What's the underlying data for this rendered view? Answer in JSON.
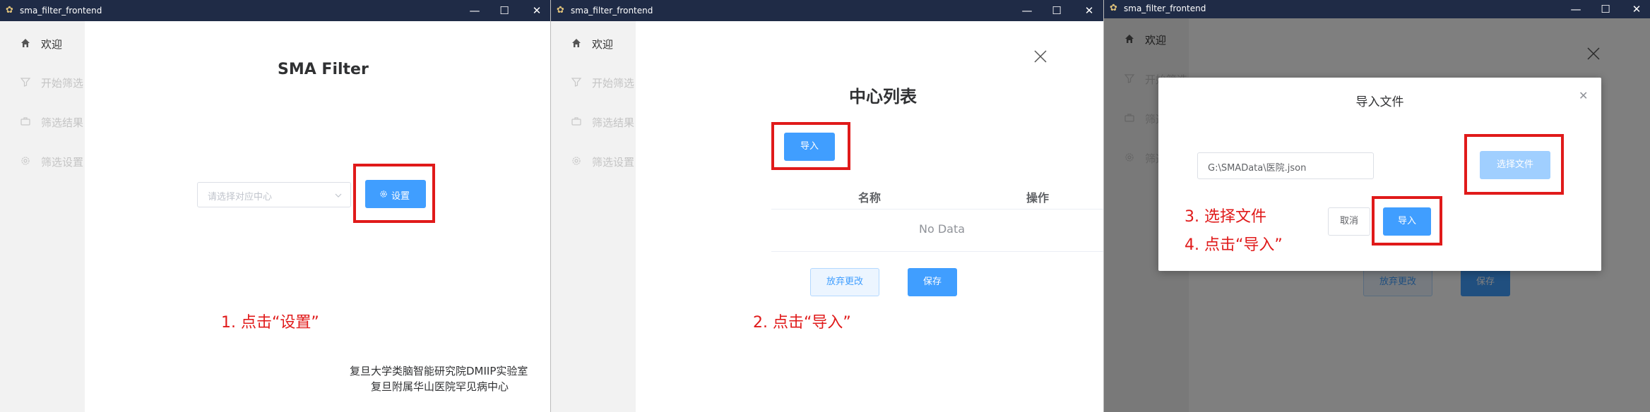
{
  "window_title": "sma_filter_frontend",
  "window_controls": {
    "minimize": "—",
    "maximize": "☐",
    "close": "✕"
  },
  "nav": [
    {
      "label": "欢迎",
      "icon": "home-icon"
    },
    {
      "label": "开始筛选",
      "icon": "filter-icon"
    },
    {
      "label": "筛选结果",
      "icon": "briefcase-icon"
    },
    {
      "label": "筛选设置",
      "icon": "gear-icon"
    }
  ],
  "panel1": {
    "title": "SMA Filter",
    "select_placeholder": "请选择对应中心",
    "settings_button": "设置",
    "annotation": "1. 点击“设置”",
    "footer_line1": "复旦大学类脑智能研究院DMIIP实验室",
    "footer_line2": "复旦附属华山医院罕见病中心"
  },
  "panel2": {
    "title": "中心列表",
    "import_button": "导入",
    "col_name": "名称",
    "col_action": "操作",
    "empty_text": "No Data",
    "discard_button": "放弃更改",
    "save_button": "保存",
    "annotation": "2. 点击“导入”"
  },
  "panel3": {
    "dialog_title": "导入文件",
    "file_path_value": "G:\\SMAData\\医院.json",
    "choose_file_button": "选择文件",
    "cancel_button": "取消",
    "import_button": "导入",
    "annotation_line1": "3. 选择文件",
    "annotation_line2": "4. 点击“导入”",
    "bg_discard_button": "放弃更改",
    "bg_save_button": "保存"
  },
  "colors": {
    "titlebar": "#1f2b46",
    "primary": "#409eff",
    "annotation_red": "#e01a1a"
  }
}
